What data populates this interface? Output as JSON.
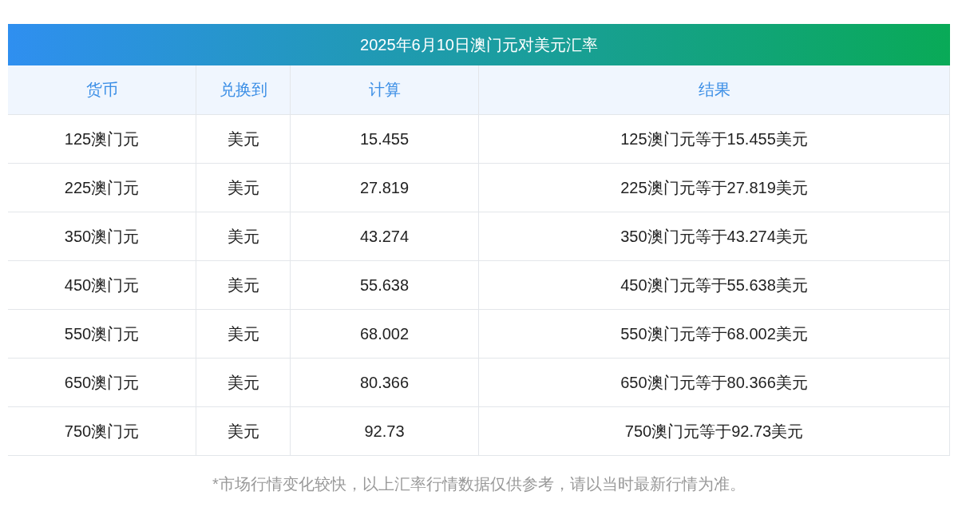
{
  "table": {
    "title": "2025年6月10日澳门元对美元汇率",
    "columns": [
      "货币",
      "兑换到",
      "计算",
      "结果"
    ],
    "rows": [
      [
        "125澳门元",
        "美元",
        "15.455",
        "125澳门元等于15.455美元"
      ],
      [
        "225澳门元",
        "美元",
        "27.819",
        "225澳门元等于27.819美元"
      ],
      [
        "350澳门元",
        "美元",
        "43.274",
        "350澳门元等于43.274美元"
      ],
      [
        "450澳门元",
        "美元",
        "55.638",
        "450澳门元等于55.638美元"
      ],
      [
        "550澳门元",
        "美元",
        "68.002",
        "550澳门元等于68.002美元"
      ],
      [
        "650澳门元",
        "美元",
        "80.366",
        "650澳门元等于80.366美元"
      ],
      [
        "750澳门元",
        "美元",
        "92.73",
        "750澳门元等于92.73美元"
      ]
    ]
  },
  "footnote": "*市场行情变化较快，以上汇率行情数据仅供参考，请以当时最新行情为准。"
}
